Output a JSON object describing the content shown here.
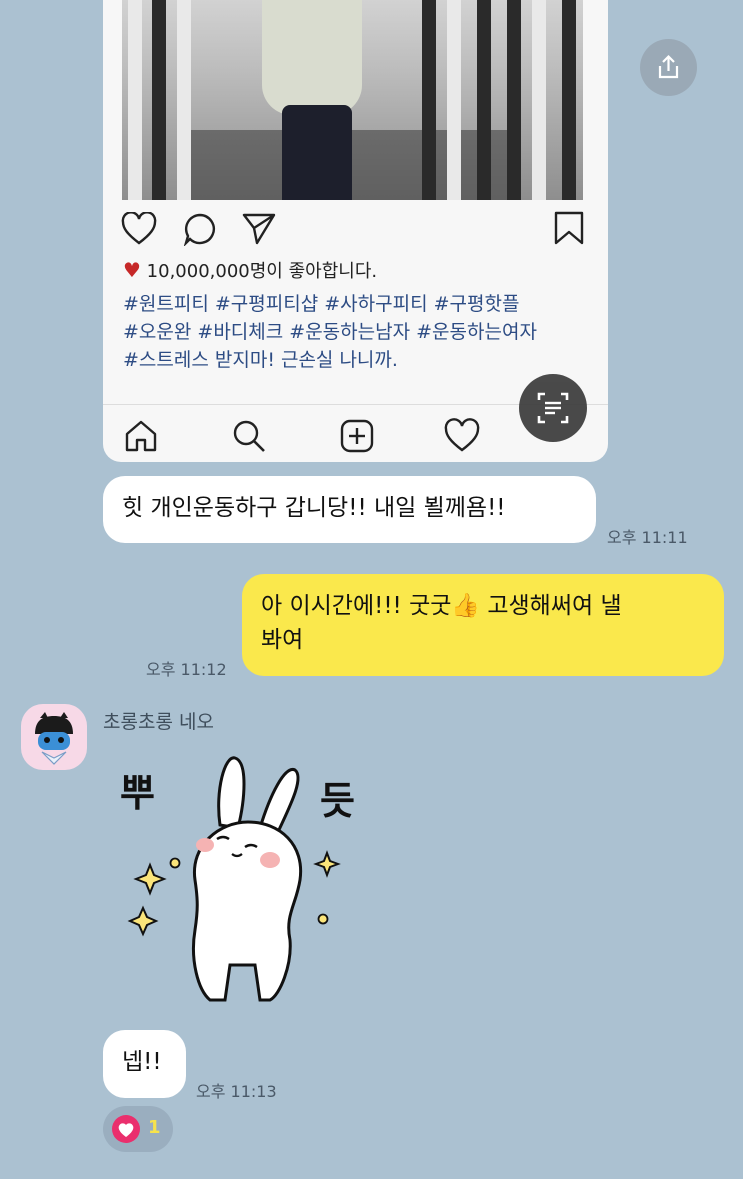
{
  "post": {
    "likes_text": "10,000,000명이 좋아합니다.",
    "hashtags": [
      "#원트피티 #구평피티샵 #사하구피티 #구평핫플",
      "#오운완 #바디체크 #운동하는남자 #운동하는여자",
      "#스트레스 받지마! 근손실 나니까."
    ]
  },
  "messages": [
    {
      "text": "힛 개인운동하구 갑니당!! 내일 뵐께욤!!",
      "time": "오후 11:11"
    },
    {
      "text_line1": "아 이시간에!!! 굿굿👍 고생해써여 낼",
      "text_line2": "봐여",
      "time": "오후 11:12"
    },
    {
      "text": "넵!!",
      "time": "오후 11:13"
    }
  ],
  "sender": {
    "name": "초롱초롱 네오"
  },
  "sticker": {
    "left_text": "뿌",
    "right_text": "듯"
  },
  "reaction": {
    "count": "1"
  },
  "colors": {
    "background": "#abc1d1",
    "my_bubble": "#fae84c",
    "other_bubble": "#ffffff",
    "reaction_heart": "#ea2f6d"
  }
}
